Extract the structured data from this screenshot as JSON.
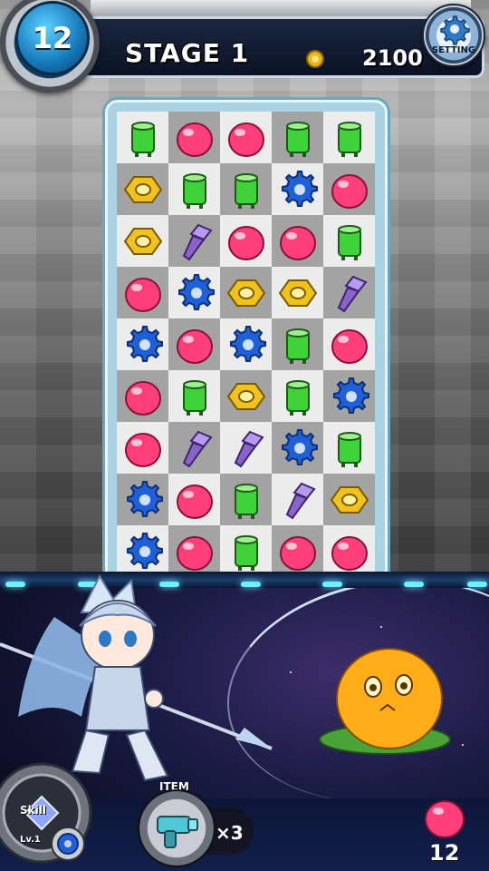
{
  "hud": {
    "level": "12",
    "stage_title": "STAGE 1",
    "score": "2100",
    "coin_icon": "coin-icon",
    "setting_label": "SETTING"
  },
  "board": {
    "rows": [
      [
        "green",
        "pink",
        "pink",
        "green",
        "green"
      ],
      [
        "yellow",
        "green",
        "green",
        "blue",
        "pink"
      ],
      [
        "yellow",
        "purple",
        "pink",
        "pink",
        "green"
      ],
      [
        "pink",
        "blue",
        "yellow",
        "yellow",
        "purple"
      ],
      [
        "blue",
        "pink",
        "blue",
        "green",
        "pink"
      ],
      [
        "pink",
        "green",
        "yellow",
        "green",
        "blue"
      ],
      [
        "pink",
        "purple",
        "purple",
        "blue",
        "green"
      ],
      [
        "blue",
        "pink",
        "green",
        "purple",
        "yellow"
      ],
      [
        "blue",
        "pink",
        "green",
        "pink",
        "pink"
      ]
    ],
    "piece_kinds": {
      "green": "green-cylinder-piece",
      "pink": "pink-gem-piece",
      "yellow": "yellow-nut-piece",
      "blue": "blue-gear-piece",
      "purple": "purple-screw-piece"
    }
  },
  "colors": {
    "green": "#3fd33a",
    "pink": "#ff3f7a",
    "yellow": "#f1c21b",
    "blue": "#1f5fd8",
    "purple": "#8a63c9",
    "board_frame": "#a9d3e3"
  },
  "bottom": {
    "skill_label": "Skill",
    "skill_level": "Lv.1",
    "item_label": "ITEM",
    "item_count": "×3",
    "target_count": "12"
  }
}
